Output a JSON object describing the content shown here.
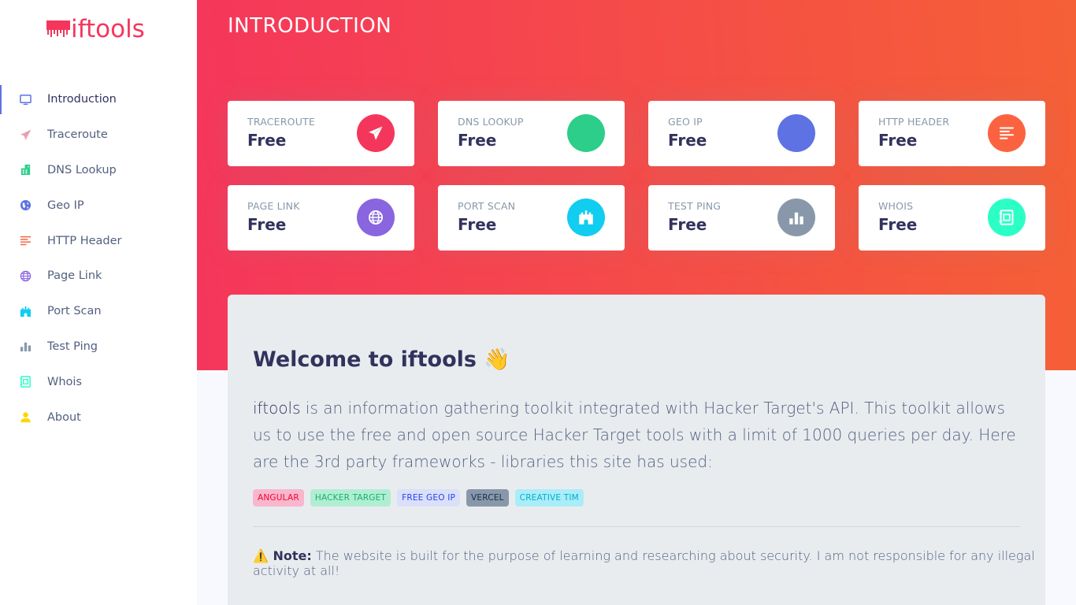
{
  "app": {
    "logo_text": "iftools",
    "page_title": "INTRODUCTION"
  },
  "sidebar": {
    "items": [
      {
        "label": "Introduction",
        "icon": "monitor-icon",
        "color": "#5e72e4",
        "active": true
      },
      {
        "label": "Traceroute",
        "icon": "send-icon",
        "color": "#f3a4b5"
      },
      {
        "label": "DNS Lookup",
        "icon": "building-icon",
        "color": "#2dce89"
      },
      {
        "label": "Geo IP",
        "icon": "globe-americas-icon",
        "color": "#5e72e4"
      },
      {
        "label": "HTTP Header",
        "icon": "align-left-icon",
        "color": "#fb6340"
      },
      {
        "label": "Page Link",
        "icon": "world-icon",
        "color": "#8965e0"
      },
      {
        "label": "Port Scan",
        "icon": "castle-icon",
        "color": "#11cdef"
      },
      {
        "label": "Test Ping",
        "icon": "chart-bar-icon",
        "color": "#8898aa"
      },
      {
        "label": "Whois",
        "icon": "notebook-icon",
        "color": "#2bffc6"
      },
      {
        "label": "About",
        "icon": "user-icon",
        "color": "#ffd600"
      }
    ]
  },
  "cards": [
    {
      "label": "TRACEROUTE",
      "value": "Free",
      "icon": "send-icon",
      "color": "#f5365c"
    },
    {
      "label": "DNS LOOKUP",
      "value": "Free",
      "icon": "building-icon",
      "color": "#2dce89"
    },
    {
      "label": "GEO IP",
      "value": "Free",
      "icon": "globe-americas-icon",
      "color": "#5e72e4"
    },
    {
      "label": "HTTP HEADER",
      "value": "Free",
      "icon": "align-left-icon",
      "color": "#fb6340"
    },
    {
      "label": "PAGE LINK",
      "value": "Free",
      "icon": "world-icon",
      "color": "#8965e0"
    },
    {
      "label": "PORT SCAN",
      "value": "Free",
      "icon": "castle-icon",
      "color": "#11cdef"
    },
    {
      "label": "TEST PING",
      "value": "Free",
      "icon": "chart-bar-icon",
      "color": "#8898aa"
    },
    {
      "label": "WHOIS",
      "value": "Free",
      "icon": "notebook-icon",
      "color": "#2bffc6"
    }
  ],
  "welcome": {
    "title": "Welcome to iftools 👋",
    "brand": "iftools",
    "body": " is an information gathering toolkit integrated with Hacker Target's API. This toolkit allows us to use the free and open source Hacker Target tools with a limit of 1000 queries per day. Here are the 3rd party frameworks - libraries this site has used:",
    "badges": [
      {
        "label": "ANGULAR",
        "bg": "#f8b7cd",
        "fg": "#f80031"
      },
      {
        "label": "HACKER TARGET",
        "bg": "#b0eed3",
        "fg": "#1aae6f"
      },
      {
        "label": "FREE GEO IP",
        "bg": "#dbe0fa",
        "fg": "#2643e9"
      },
      {
        "label": "VERCEL",
        "bg": "#8898aa",
        "fg": "#172b4d"
      },
      {
        "label": "CREATIVE TIM",
        "bg": "#aaedf9",
        "fg": "#03acca"
      }
    ],
    "note_label": "⚠️ Note:",
    "note_text": " The website is built for the purpose of learning and researching about security. I am not responsible for any illegal activity at all!"
  }
}
